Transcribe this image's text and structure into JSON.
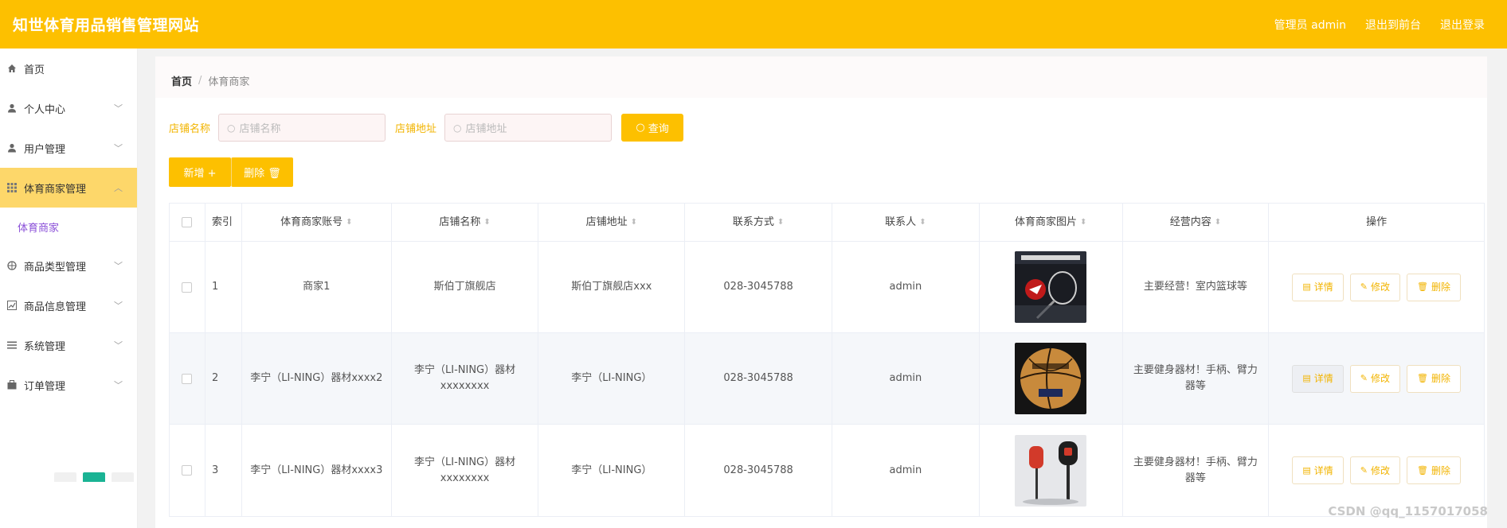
{
  "header": {
    "site_title": "知世体育用品销售管理网站",
    "user_label": "管理员 admin",
    "front_link": "退出到前台",
    "logout_link": "退出登录"
  },
  "sidebar": {
    "items": [
      {
        "label": "首页",
        "icon": "home-icon"
      },
      {
        "label": "个人中心",
        "icon": "user-icon"
      },
      {
        "label": "用户管理",
        "icon": "user-icon"
      },
      {
        "label": "体育商家管理",
        "icon": "grid-icon"
      },
      {
        "label": "商品类型管理",
        "icon": "category-icon"
      },
      {
        "label": "商品信息管理",
        "icon": "chart-icon"
      },
      {
        "label": "系统管理",
        "icon": "list-icon"
      },
      {
        "label": "订单管理",
        "icon": "order-icon"
      }
    ],
    "sub_item": "体育商家"
  },
  "breadcrumb": {
    "home": "首页",
    "separator": "/",
    "current": "体育商家"
  },
  "filters": {
    "shop_label": "店铺名称",
    "shop_placeholder": "店铺名称",
    "addr_label": "店铺地址",
    "addr_placeholder": "店铺地址",
    "query_label": "查询"
  },
  "actions": {
    "add_label": "新增 +",
    "delete_label": "删除 🗑"
  },
  "table": {
    "headers": [
      "索引",
      "体育商家账号",
      "店铺名称",
      "店铺地址",
      "联系方式",
      "联系人",
      "体育商家图片",
      "经营内容",
      "操作"
    ],
    "rows": [
      {
        "index": "1",
        "account": "商家1",
        "shop": "斯伯丁旗舰店",
        "address": "斯伯丁旗舰店xxx",
        "phone": "028-3045788",
        "contact": "admin",
        "image": "badminton-racket-image",
        "business": "主要经营！室内篮球等"
      },
      {
        "index": "2",
        "account": "李宁（LI-NING）器材xxxx2",
        "shop": "李宁（LI-NING）器材xxxxxxxx",
        "address": "李宁（LI-NING）",
        "phone": "028-3045788",
        "contact": "admin",
        "image": "basketball-image",
        "business": "主要健身器材！手柄、臂力器等"
      },
      {
        "index": "3",
        "account": "李宁（LI-NING）器材xxxx3",
        "shop": "李宁（LI-NING）器材xxxxxxxx",
        "address": "李宁（LI-NING）",
        "phone": "028-3045788",
        "contact": "admin",
        "image": "punching-bag-image",
        "business": "主要健身器材！手柄、臂力器等"
      }
    ],
    "op_labels": {
      "detail": "详情",
      "edit": "修改",
      "delete": "删除"
    }
  },
  "watermark": "CSDN @qq_1157017058",
  "colors": {
    "accent": "#fdc000",
    "sub_active": "#8a4fd8",
    "page_active": "#1ab394"
  }
}
